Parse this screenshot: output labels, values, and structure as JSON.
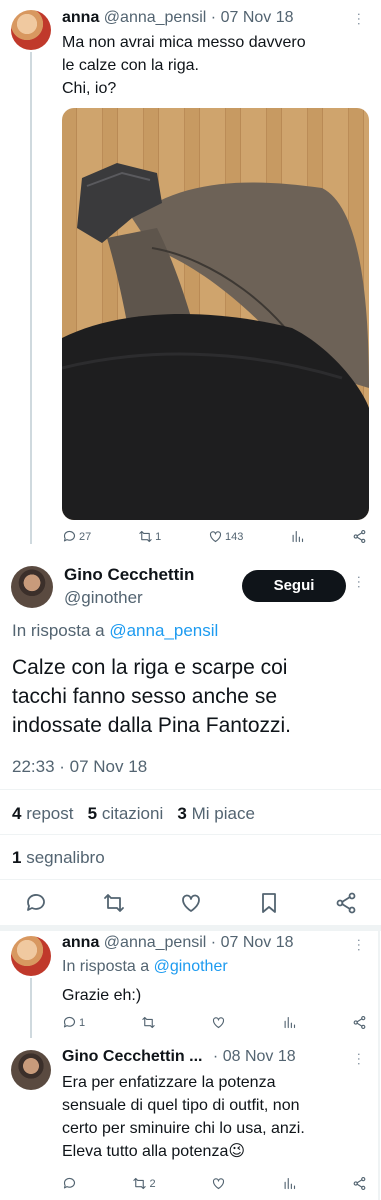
{
  "tweet1": {
    "name": "anna",
    "handle": "@anna_pensil",
    "date": "· 07 Nov 18",
    "text_lines": [
      "Ma non avrai mica messo davvero",
      "le calze con la riga.",
      "Chi, io?"
    ],
    "stats": {
      "replies": "27",
      "reposts": "1",
      "likes": "143"
    }
  },
  "main_tweet": {
    "name": "Gino Cecchettin",
    "handle": "@ginother",
    "follow_label": "Segui",
    "reply_to_prefix": "In risposta a",
    "reply_to_handle": "@anna_pensil",
    "text_lines": [
      "Calze con la riga e scarpe coi",
      "tacchi fanno sesso anche se",
      "indossate dalla Pina Fantozzi."
    ],
    "timestamp": "22:33 · 07 Nov 18",
    "counts": {
      "reposts_num": "4",
      "reposts_label": "repost",
      "quotes_num": "5",
      "quotes_label": "citazioni",
      "likes_num": "3",
      "likes_label": "Mi piace",
      "bookmarks_num": "1",
      "bookmarks_label": "segnalibro"
    }
  },
  "reply1": {
    "name": "anna",
    "handle": "@anna_pensil",
    "date": "· 07 Nov 18",
    "reply_to_prefix": "In risposta a",
    "reply_to_handle": "@ginother",
    "text": "Grazie eh:)",
    "stats": {
      "replies": "1"
    }
  },
  "reply2": {
    "name": "Gino Cecchettin ...",
    "date": "· 08 Nov 18",
    "text_lines": [
      "Era per enfatizzare la potenza",
      "sensuale di quel tipo di outfit, non",
      "certo per sminuire chi lo usa, anzi.",
      "Eleva tutto alla potenza"
    ],
    "emoji": "😉",
    "stats": {
      "reposts": "2"
    }
  },
  "colors": {
    "link": "#1d9bf0",
    "muted": "#536471",
    "follow_bg": "#0f1419"
  },
  "icons": [
    "reply-icon",
    "repost-icon",
    "like-icon",
    "views-icon",
    "share-icon",
    "bookmark-icon",
    "more-icon"
  ]
}
